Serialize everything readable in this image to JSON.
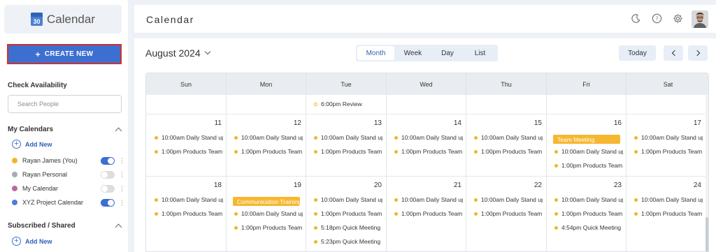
{
  "sidebar": {
    "logo_text": "Calendar",
    "logo_icon_number": "30",
    "create_new_label": "CREATE NEW",
    "check_availability_title": "Check Availability",
    "search_placeholder": "Search People",
    "my_calendars_title": "My Calendars",
    "add_new_label": "Add New",
    "calendars": [
      {
        "name": "Rayan James (You)",
        "color": "#f2b52a",
        "enabled": true
      },
      {
        "name": "Rayan Personal",
        "color": "#a8acb2",
        "enabled": false
      },
      {
        "name": "My Calendar",
        "color": "#b86aa0",
        "enabled": false
      },
      {
        "name": "XYZ Project Calendar",
        "color": "#4a7fd4",
        "enabled": true
      }
    ],
    "subscribed_title": "Subscribed / Shared",
    "add_new_label_2": "Add New"
  },
  "header": {
    "title": "Calendar",
    "icons": [
      "moon-icon",
      "help-icon",
      "gear-icon",
      "avatar"
    ]
  },
  "toolbar": {
    "month_label": "August 2024",
    "views": [
      "Month",
      "Week",
      "Day",
      "List"
    ],
    "active_view": "Month",
    "today_label": "Today"
  },
  "calendar": {
    "weekdays": [
      "Sun",
      "Mon",
      "Tue",
      "Wed",
      "Thu",
      "Fri",
      "Sat"
    ],
    "partial_row": {
      "tue_event": "6:00pm Review"
    },
    "week1": {
      "days": [
        "11",
        "12",
        "13",
        "14",
        "15",
        "16",
        "17"
      ],
      "standup": "10:00am Daily Stand up",
      "products": "1:00pm Products Team",
      "fri_bar": "Team Meeting"
    },
    "week2": {
      "days": [
        "18",
        "19",
        "20",
        "21",
        "22",
        "23",
        "24"
      ],
      "standup": "10:00am Daily Stand up",
      "products": "1:00pm Products Team",
      "mon_bar": "Communication Training",
      "tue_extra1": "5:18pm Quick Meeting",
      "tue_extra2": "5:23pm Quick Meeting",
      "fri_extra": "4:54pm Quick Meeting"
    }
  },
  "colors": {
    "accent": "#3d6fd0",
    "event": "#f6b731"
  }
}
